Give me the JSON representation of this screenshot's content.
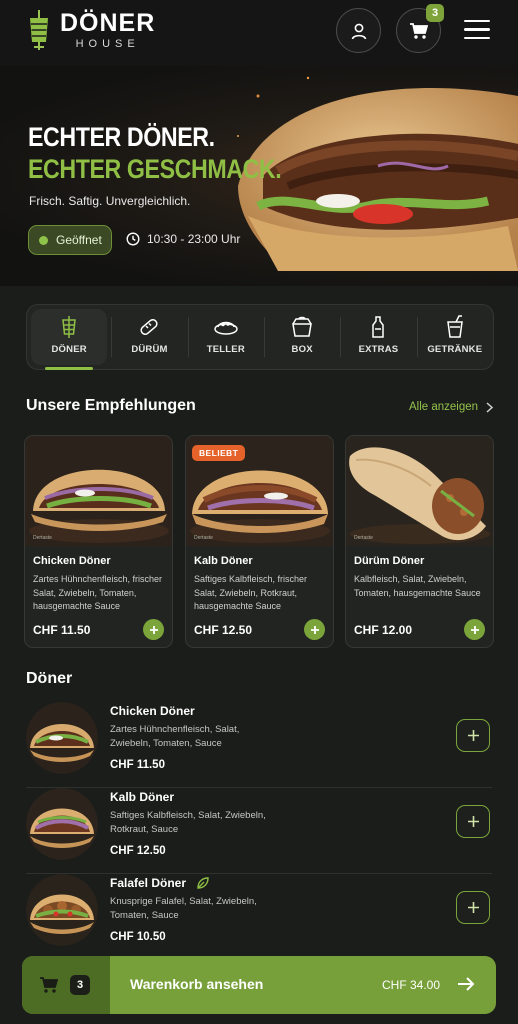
{
  "brand": {
    "name": "DÖNER",
    "subtitle": "HOUSE"
  },
  "header": {
    "cart_count": "3"
  },
  "hero": {
    "title_line1": "ECHTER DÖNER.",
    "title_line2": "ECHTER GESCHMACK.",
    "subtitle": "Frisch. Saftig. Unvergleichlich.",
    "status": "Geöffnet",
    "hours": "10:30 - 23:00 Uhr"
  },
  "categories": [
    {
      "label": "DÖNER",
      "icon": "doner-icon",
      "active": true
    },
    {
      "label": "DÜRÜM",
      "icon": "wrap-icon"
    },
    {
      "label": "TELLER",
      "icon": "plate-icon"
    },
    {
      "label": "BOX",
      "icon": "box-icon"
    },
    {
      "label": "EXTRAS",
      "icon": "sauce-bottle-icon"
    },
    {
      "label": "GETRÄNKE",
      "icon": "drink-icon"
    }
  ],
  "recommendations": {
    "title": "Unsere Empfehlungen",
    "see_all": "Alle anzeigen",
    "items": [
      {
        "name": "Chicken Döner",
        "desc": "Zartes Hühnchenfleisch, frischer Salat, Zwiebeln, Tomaten, hausgemachte Sauce",
        "price": "CHF 11.50",
        "tag": "Dertaste"
      },
      {
        "name": "Kalb Döner",
        "desc": "Saftiges Kalbfleisch, frischer Salat, Zwiebeln, Rotkraut, hausgemachte Sauce",
        "price": "CHF 12.50",
        "badge": "BELIEBT",
        "tag": "Dertaste"
      },
      {
        "name": "Dürüm Döner",
        "desc": "Kalbfleisch, Salat, Zwiebeln, Tomaten, hausgemachte Sauce",
        "price": "CHF 12.00",
        "tag": "Dertaste"
      }
    ]
  },
  "doner_section": {
    "title": "Döner",
    "items": [
      {
        "name": "Chicken Döner",
        "desc": "Zartes Hühnchenfleisch, Salat, Zwiebeln, Tomaten, Sauce",
        "price": "CHF 11.50"
      },
      {
        "name": "Kalb Döner",
        "desc": "Saftiges Kalbfleisch, Salat, Zwiebeln, Rotkraut, Sauce",
        "price": "CHF 12.50"
      },
      {
        "name": "Falafel Döner",
        "desc": "Knusprige Falafel, Salat, Zwiebeln, Tomaten, Sauce",
        "price": "CHF 10.50",
        "vegan": true
      }
    ]
  },
  "cart_bar": {
    "count": "3",
    "label": "Warenkorb ansehen",
    "total": "CHF 34.00"
  },
  "colors": {
    "accent": "#8fbf45",
    "bar": "#78a03a",
    "badge": "#e5622a",
    "background": "#1b1d1b"
  }
}
